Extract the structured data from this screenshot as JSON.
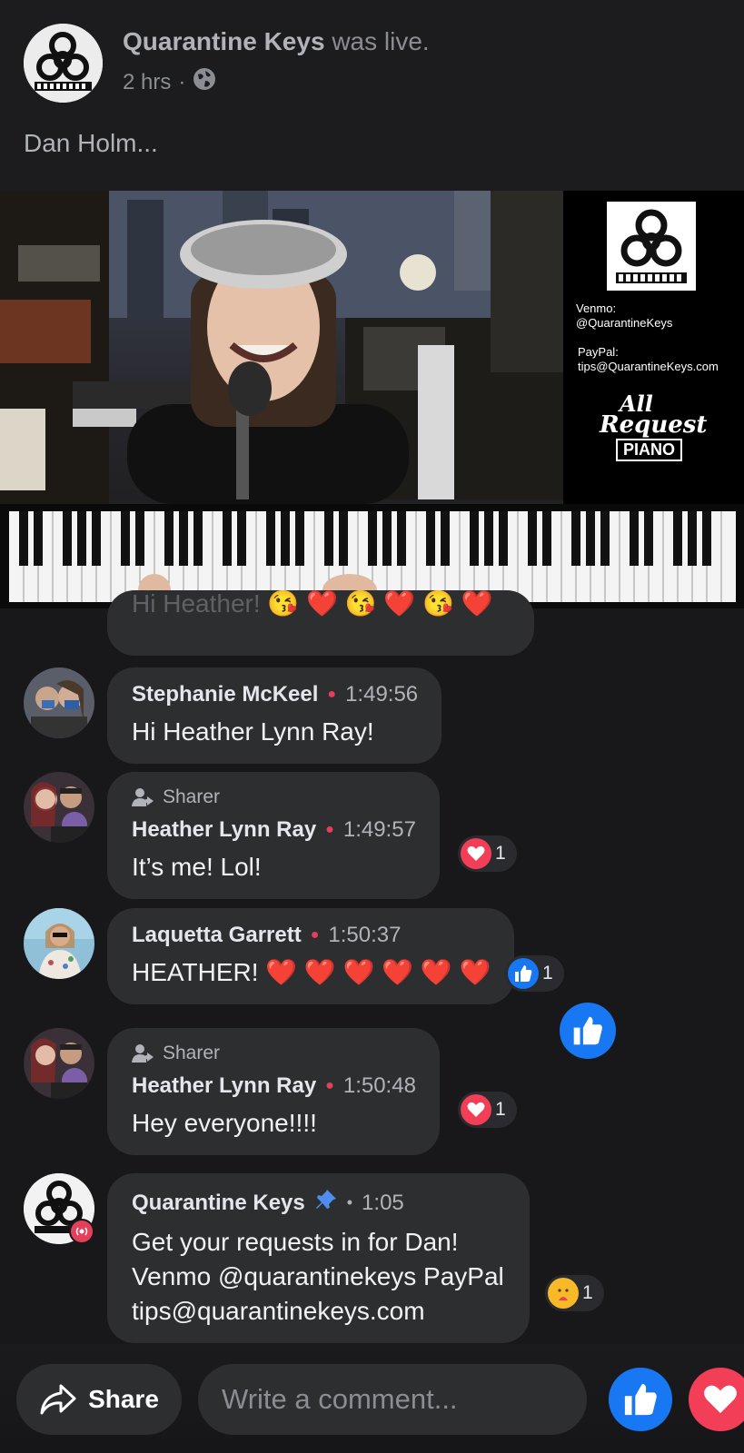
{
  "post": {
    "page_name": "Quarantine Keys",
    "status": "was live.",
    "age": "2 hrs",
    "separator": "·",
    "audience_icon": "globe-icon",
    "text": "Dan Holm..."
  },
  "video": {
    "panel_venmo_label": "Venmo:",
    "panel_venmo_handle": "@QuarantineKeys",
    "panel_paypal_label": "PayPal:",
    "panel_paypal_email": "tips@QuarantineKeys.com",
    "panel_logo_line1": "All",
    "panel_logo_line2": "Request",
    "panel_logo_line3": "PIANO"
  },
  "partial_comment": {
    "text": "Hi Heather! 😘 ❤️ 😘 ❤️ 😘 ❤️"
  },
  "comments": [
    {
      "author": "Stephanie McKeel",
      "time": "1:49:56",
      "text": "Hi Heather Lynn Ray!"
    },
    {
      "badge": "Sharer",
      "author": "Heather Lynn Ray",
      "time": "1:49:57",
      "text": "It’s me! Lol!",
      "reaction_icon": "heart-icon",
      "reaction_count": "1"
    },
    {
      "author": "Laquetta Garrett",
      "time": "1:50:37",
      "text": "HEATHER! ❤️ ❤️ ❤️ ❤️ ❤️ ❤️",
      "reaction_icon": "like-icon",
      "reaction_count": "1"
    },
    {
      "badge": "Sharer",
      "author": "Heather Lynn Ray",
      "time": "1:50:48",
      "text": "Hey everyone!!!!",
      "reaction_icon": "heart-icon",
      "reaction_count": "1"
    },
    {
      "author": "Quarantine Keys",
      "pinned_icon": "pin-icon",
      "time": "1:05",
      "text_line1": "Get your requests in for Dan!",
      "text_line2": "Venmo @quarantinekeys PayPal",
      "text_line3": "tips@quarantinekeys.com",
      "reaction_icon": "care-icon",
      "reaction_count": "1"
    }
  ],
  "footer": {
    "share_label": "Share",
    "comment_placeholder": "Write a comment..."
  },
  "colors": {
    "background": "#18181a",
    "bubble": "#2d2e30",
    "like_blue": "#1877f2",
    "love_red": "#f33e58",
    "live_dot": "#e4405b"
  }
}
